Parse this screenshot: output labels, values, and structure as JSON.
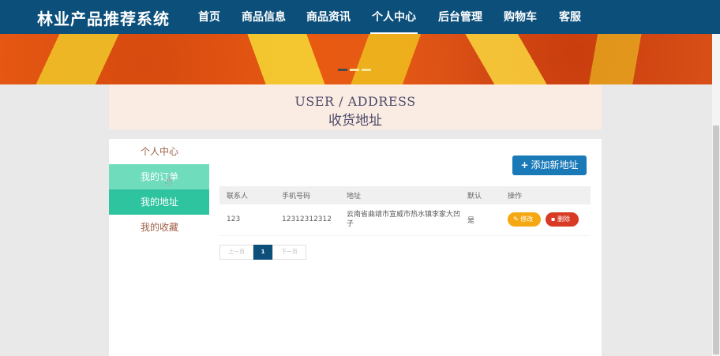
{
  "brand": "林业产品推荐系统",
  "nav": [
    {
      "label": "首页"
    },
    {
      "label": "商品信息"
    },
    {
      "label": "商品资讯"
    },
    {
      "label": "个人中心",
      "active": true
    },
    {
      "label": "后台管理"
    },
    {
      "label": "购物车"
    },
    {
      "label": "客服"
    }
  ],
  "banner": {
    "dots": 3,
    "active_dot": 1
  },
  "page_title": {
    "en": "USER / ADDRESS",
    "cn": "收货地址"
  },
  "sidebar": {
    "items": [
      {
        "label": "个人中心"
      },
      {
        "label": "我的订单",
        "state": "hover"
      },
      {
        "label": "我的地址",
        "state": "active"
      },
      {
        "label": "我的收藏"
      }
    ]
  },
  "add_button": {
    "icon": "plus-icon",
    "label": "添加新地址"
  },
  "table": {
    "headers": [
      "联系人",
      "手机号码",
      "地址",
      "默认",
      "操作"
    ],
    "rows": [
      {
        "contact": "123",
        "phone": "12312312312",
        "address": "云南省曲靖市宣威市热水镇李家大凹子",
        "default": "是",
        "edit_label": "修改",
        "delete_label": "删除"
      }
    ]
  },
  "pagination": {
    "prev": "上一页",
    "current": "1",
    "next": "下一页"
  },
  "colors": {
    "nav_bg": "#0b4f7a",
    "accent_green": "#2fc4a0",
    "hover_green": "#6fdcbc",
    "primary_blue": "#1a7ab8",
    "edit_orange": "#f5a812",
    "delete_red": "#d83a24"
  }
}
